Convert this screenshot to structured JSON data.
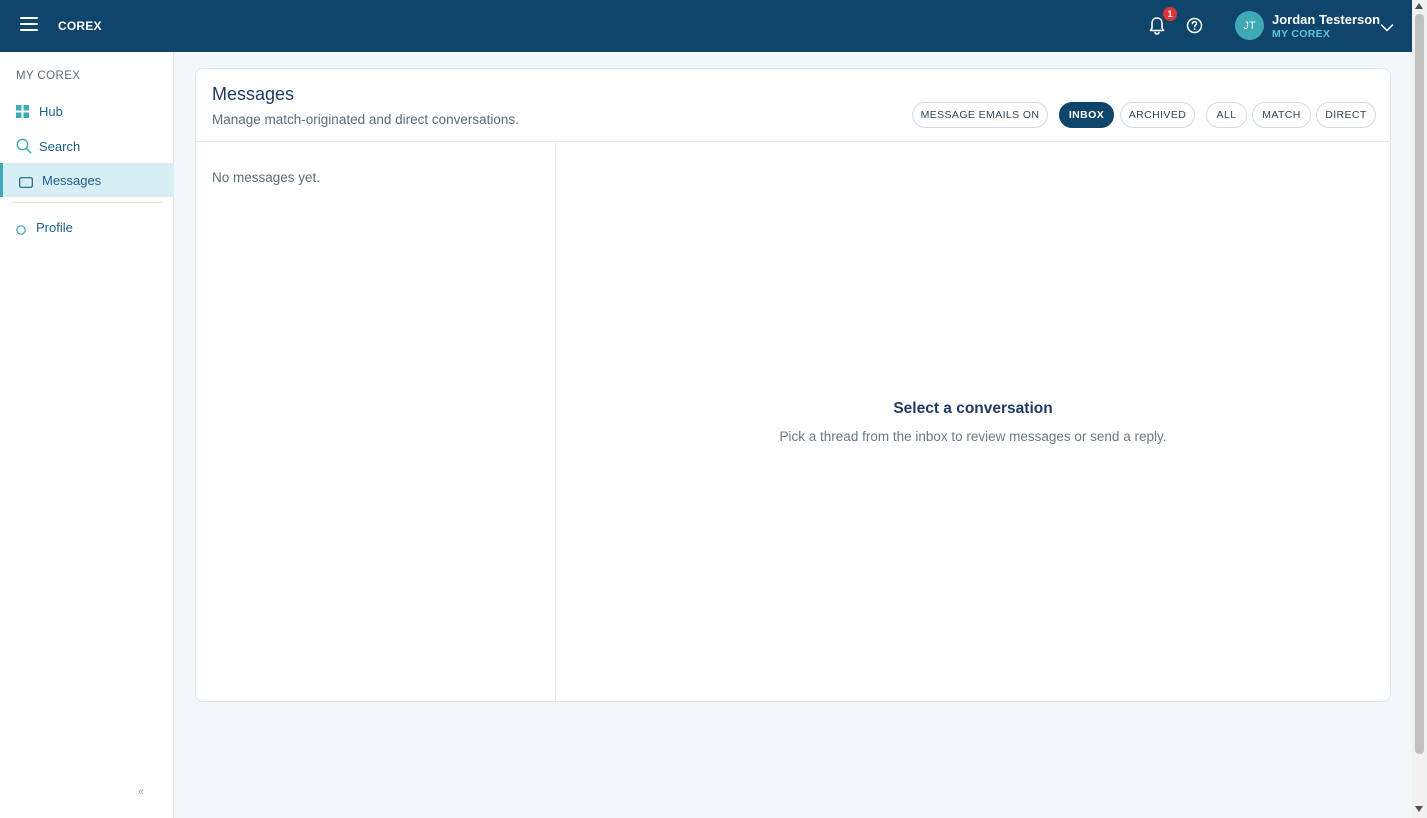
{
  "app": {
    "brand": "COREX",
    "notification_count": "1",
    "user": {
      "initials": "JT",
      "name": "Jordan Testerson",
      "subtitle": "MY COREX"
    }
  },
  "sidebar": {
    "heading": "MY COREX",
    "items": [
      {
        "label": "Hub",
        "icon": "grid-icon"
      },
      {
        "label": "Search",
        "icon": "search-icon"
      },
      {
        "label": "Messages",
        "icon": "message-icon",
        "active": true
      },
      {
        "label": "Profile",
        "icon": "circle-icon"
      }
    ],
    "collapse_label": "«"
  },
  "messages": {
    "title": "Messages",
    "subtitle": "Manage match-originated and direct conversations.",
    "toggle_emails": "MESSAGE EMAILS ON",
    "folder_filters": [
      {
        "label": "INBOX",
        "active": true
      },
      {
        "label": "ARCHIVED",
        "active": false
      }
    ],
    "type_filters": [
      {
        "label": "ALL"
      },
      {
        "label": "MATCH"
      },
      {
        "label": "DIRECT"
      }
    ],
    "empty_list": "No messages yet.",
    "detail_title": "Select a conversation",
    "detail_subtitle": "Pick a thread from the inbox to review messages or send a reply."
  },
  "colors": {
    "topbar": "#0f456b",
    "accent": "#3fa9b5",
    "badge": "#e0343b",
    "active_bg": "#d7eff4"
  }
}
